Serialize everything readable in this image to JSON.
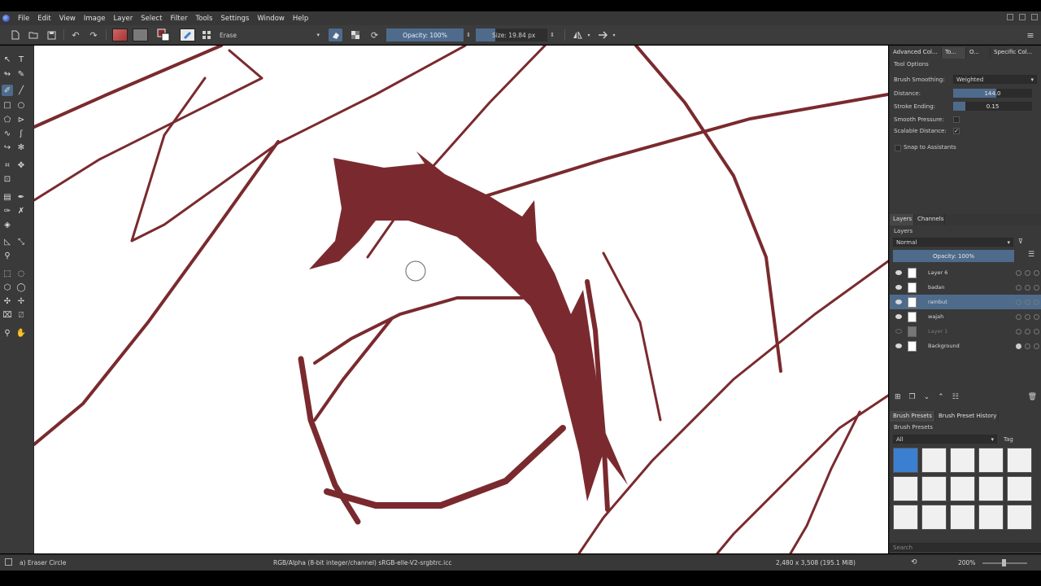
{
  "menu": [
    "File",
    "Edit",
    "View",
    "Image",
    "Layer",
    "Select",
    "Filter",
    "Tools",
    "Settings",
    "Window",
    "Help"
  ],
  "toolbar": {
    "blend_mode": "Erase",
    "opacity": "Opacity: 100%",
    "size": "Size: 19.84 px"
  },
  "dock": {
    "tabs": [
      "Advanced Col...",
      "To...",
      "O...",
      "Specific Col..."
    ],
    "tool_options_title": "Tool Options",
    "brush_smoothing_label": "Brush Smoothing:",
    "brush_smoothing_value": "Weighted",
    "distance_label": "Distance:",
    "distance_value": "144.0",
    "distance_fraction": 0.55,
    "stroke_ending_label": "Stroke Ending:",
    "stroke_ending_value": "0.15",
    "stroke_ending_fraction": 0.15,
    "smooth_pressure_label": "Smooth Pressure:",
    "scalable_distance_label": "Scalable Distance:",
    "scalable_distance_check": "✓",
    "snap_label": "Snap to Assistants",
    "layer_tabs": [
      "Layers",
      "Channels"
    ],
    "layers_title": "Layers",
    "blending": "Normal",
    "layer_opacity": "Opacity:  100%",
    "layers": [
      {
        "name": "Layer 6"
      },
      {
        "name": "badan"
      },
      {
        "name": "rambut"
      },
      {
        "name": "wajah"
      },
      {
        "name": "Layer 1"
      },
      {
        "name": "Background"
      }
    ],
    "preset_tabs": [
      "Brush Presets",
      "Brush Preset History"
    ],
    "presets_title": "Brush Presets",
    "preset_filter": "All",
    "preset_tag": "Tag",
    "search_placeholder": "Search"
  },
  "status": {
    "tool": "a) Eraser Circle",
    "color_space": "RGB/Alpha (8-bit integer/channel)  sRGB-elle-V2-srgbtrc.icc",
    "dimensions": "2,480 x 3,508 (195.1 MiB)",
    "zoom": "200%"
  },
  "colors": {
    "ink": "#7a2a2e",
    "selection": "#4e6b8c"
  }
}
